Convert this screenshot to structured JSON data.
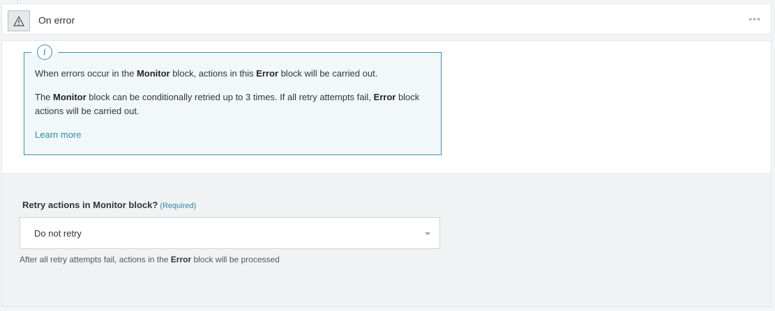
{
  "header": {
    "icon": "warning-triangle-icon",
    "title": "On error",
    "more_icon": "more-dots-icon"
  },
  "info": {
    "icon": "info-circle-icon",
    "line1": {
      "p1": "When errors occur in the ",
      "b1": "Monitor",
      "p2": " block, actions in this ",
      "b2": "Error",
      "p3": " block will be carried out."
    },
    "line2": {
      "p1": "The ",
      "b1": "Monitor",
      "p2": " block can be conditionally retried up to 3 times. If all retry attempts fail, ",
      "b2": "Error",
      "p3": " block actions will be carried out."
    },
    "learn_more": "Learn more"
  },
  "retry": {
    "label": "Retry actions in Monitor block?",
    "required": "(Required)",
    "selected": "Do not retry",
    "hint": {
      "p1": "After all retry attempts fail, actions in the ",
      "b1": "Error",
      "p2": " block will be processed"
    }
  },
  "colors": {
    "accent": "#2a8ca0",
    "info_border": "#3b8fb0",
    "info_bg": "#f2f8fa"
  }
}
